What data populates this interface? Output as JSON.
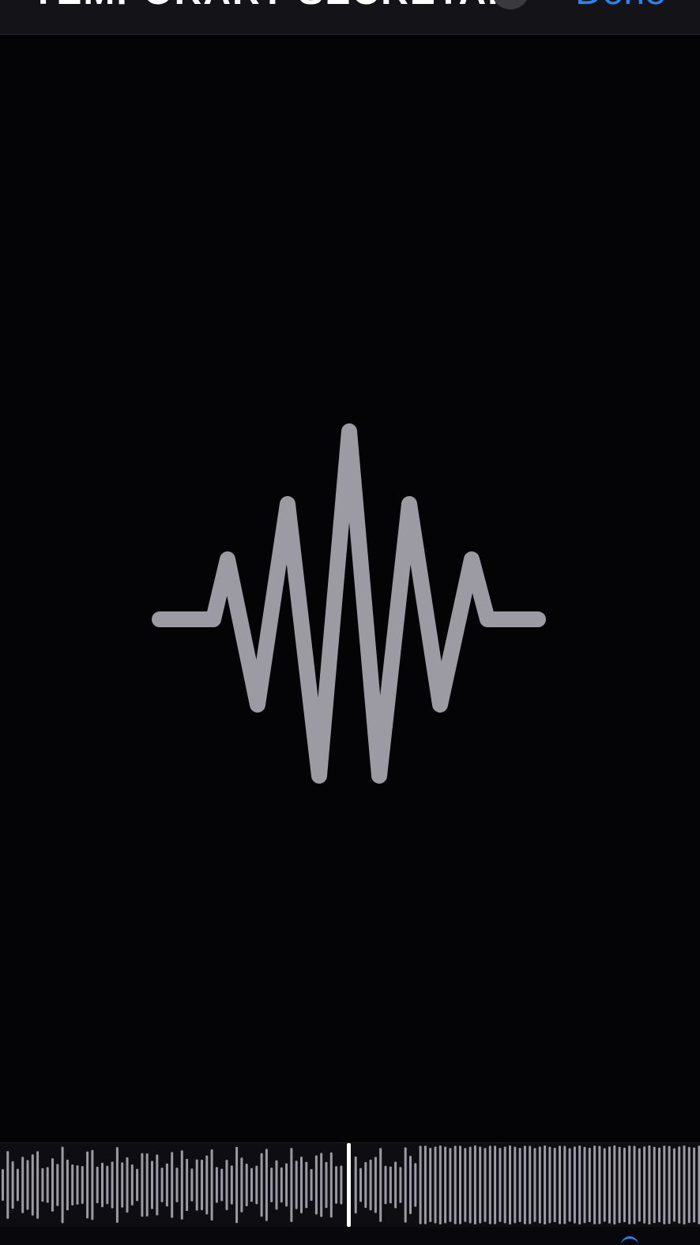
{
  "header": {
    "title": "TEMPORARY SECRETA...",
    "more_icon": "ellipsis-circle-icon",
    "done_label": "Done"
  },
  "main": {
    "icon": "waveform-icon"
  },
  "scrubber": {
    "icon": "audio-waveform-scrubber",
    "playhead_icon": "playhead-line-icon",
    "playhead_position": 0.5
  },
  "colors": {
    "background": "#040306",
    "bar": "#141318",
    "accent": "#2a84f6",
    "icon": "#9c9aa3",
    "playhead": "#ffffff"
  }
}
